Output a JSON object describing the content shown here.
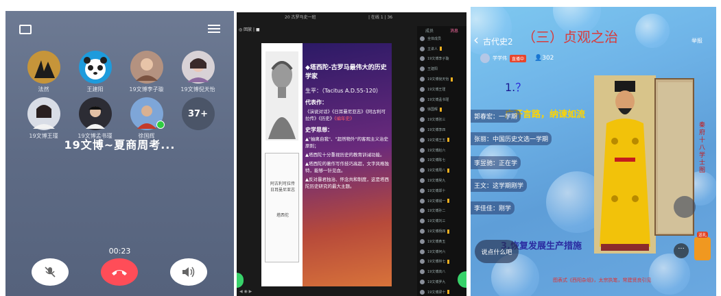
{
  "call": {
    "participants": [
      {
        "name": "法然"
      },
      {
        "name": "王建阳"
      },
      {
        "name": "19文博李子璇"
      },
      {
        "name": "19文博倪天怡"
      },
      {
        "name": "19文博王瑾"
      },
      {
        "name": "19文博孟书瑾"
      },
      {
        "name": "徐国辉"
      }
    ],
    "more_count": "37+",
    "title": "19文博~夏商周考...",
    "timer": "00:23",
    "icons": [
      "minimize-icon",
      "menu-icon",
      "mic-muted-icon",
      "hang-up-icon",
      "speaker-icon"
    ],
    "colors": {
      "hangup": "#ff4d58",
      "bg": "#5e6b85"
    }
  },
  "slide_app": {
    "app_title": "20 古罗马史一班",
    "top_info": "| 在线 1 | 36",
    "toolbar": "◎ 回放  |  ■",
    "sidebar_tabs": [
      "成员",
      "消息"
    ],
    "sidebar_rows": [
      "全体成员",
      "主讲人",
      "19文博李子璇",
      "王建阳",
      "19文博倪天怡",
      "19文博王瑾",
      "19文博孟书瑾",
      "徐国辉",
      "19文博张三",
      "19文博李四",
      "19文博王五",
      "19文博赵六",
      "19文博陈七",
      "19文博周八",
      "19文博吴九",
      "19文博郑十",
      "19文博钱一",
      "19文博孙二",
      "19文博刘三",
      "19文博杨四",
      "19文博黄五",
      "19文博何六",
      "19文博林七",
      "19文博高八",
      "19文博罗九",
      "19文博梁十"
    ],
    "slide": {
      "title": "◆塔西陀-古罗马最伟大的历史学家",
      "life": "生平：（Tacitus A.D.55-120）",
      "works_label": "代表作：",
      "works": "《演说对话》《日耳曼尼亚志》《阿古利可拉传》《历史》",
      "works_red": "《编年史》",
      "thought_label": "史学思想：",
      "points": [
        "▲\"抽离自我\"、\"超然物外\"的客观主义治史原则；",
        "▲塔西陀十分重视历史的教育训诫功能。",
        "▲塔西陀的著作写作技巧高超，文字风格独特，能够一针见血。",
        "▲反对暴君独治、怀念共和制度，这是塔西陀历史研究的最大主题。"
      ],
      "book_title": "阿古利可拉传 日耳曼尼亚志",
      "book_sub": "塔西佗"
    },
    "bottom_nav": "◀  ◉  ▶"
  },
  "live": {
    "back_class": "古代史2",
    "section_title": "（三）贞观之治",
    "report": "举报",
    "host_name": "学学伟",
    "host_badge": "直播中",
    "viewers": "302",
    "heading1_num": "1.",
    "heading1": "？",
    "motto": "广开言路，纳谏如流",
    "heading3": "3.恢复发展生产措施",
    "caption": "图表式《西阳杂俎》，太宗执笔，常建贤良引见",
    "side_red": "秦府十八学士图",
    "comments": [
      {
        "user": "郭春宏",
        "text": "一学期"
      },
      {
        "user": "张丽",
        "text": "中国历史文选一学期"
      },
      {
        "user": "李昱驰",
        "text": "正在学"
      },
      {
        "user": "王文",
        "text": "这学期刚学"
      },
      {
        "user": "李佳佳",
        "text": "刚学"
      }
    ],
    "chat_placeholder": "说点什么吧",
    "gift_tag": "送礼",
    "more_label": "···"
  }
}
